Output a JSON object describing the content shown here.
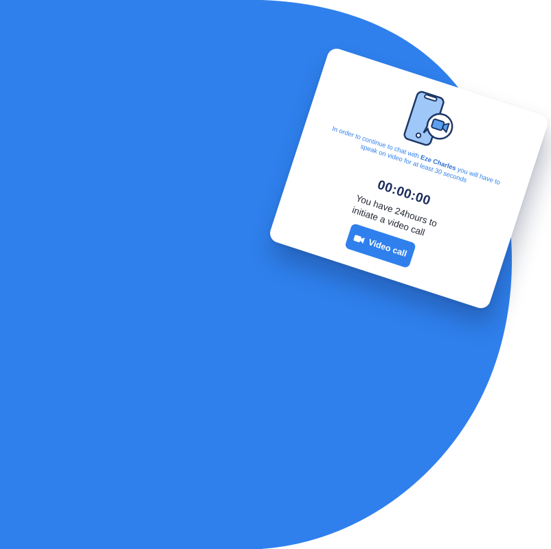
{
  "colors": {
    "accent": "#2f80ed",
    "timer": "#1a2c5b",
    "card": "#ffffff"
  },
  "prompt": {
    "text_before": "In order to continue to chat with ",
    "contact_name": "Eze Charles",
    "text_after": " you will have to speak on video for at least 30 seconds"
  },
  "timer": {
    "value": "00:00:00"
  },
  "info": {
    "text": "You have 24hours to initiate a video call"
  },
  "action": {
    "label": "Video call",
    "icon": "video-camera-icon"
  },
  "illustration": {
    "icon": "phone-video-call-icon"
  }
}
